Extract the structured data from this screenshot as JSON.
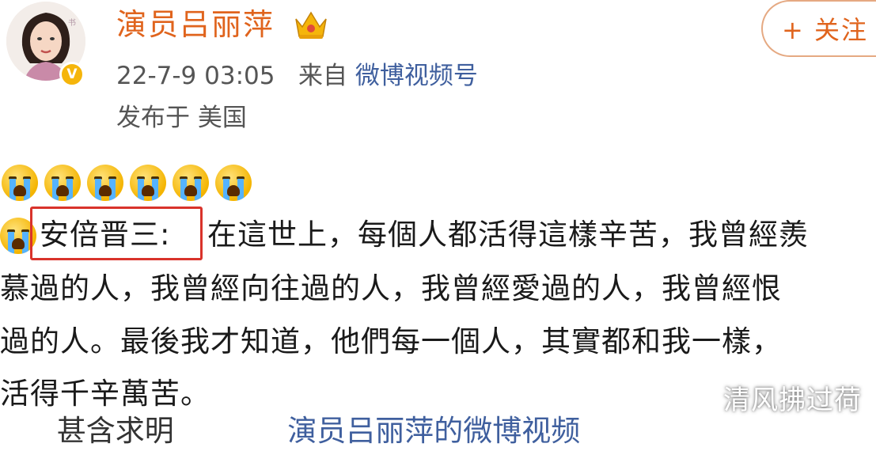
{
  "post": {
    "author": "演员吕丽萍",
    "follow_label": "+ 关注",
    "timestamp": "22-7-9 03:05",
    "source_prefix": "来自",
    "source": "微博视频号",
    "location": "发布于 美国"
  },
  "content": {
    "emoji_name": "crying-face",
    "emoji_count": 6,
    "quote_speaker": "安倍晋三:",
    "lines": [
      "在這世上，每個人都活得這樣辛苦，我曾經羨",
      "慕過的人，我曾經向往過的人，我曾經愛過的人，我曾經恨",
      "過的人。最後我才知道，他們每一個人，其實都和我一樣，",
      "活得千辛萬苦。"
    ],
    "partial_line_text": "甚含求明",
    "partial_link": "演员吕丽萍的微博视频"
  },
  "watermark": "清风拂过荷",
  "colors": {
    "author": "#e0641d",
    "source_link": "#3f5f9e",
    "highlight_box": "#d9332b",
    "verified_badge": "#f5b50b"
  }
}
